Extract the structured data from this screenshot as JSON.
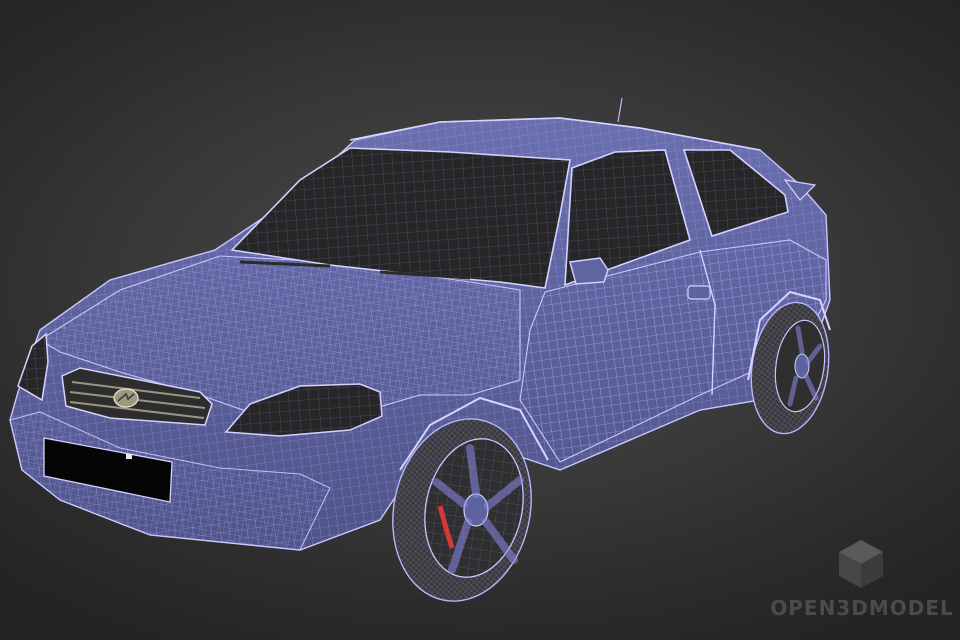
{
  "scene": {
    "subject": "car-wireframe-model",
    "background_color": "#2e2e2e",
    "wireframe_color": "#a9a6ff",
    "body_color": "#5a5f96",
    "glass_color": "#262626"
  },
  "watermark": {
    "text": "OPEN3DMODEL",
    "icon": "cube-icon"
  }
}
